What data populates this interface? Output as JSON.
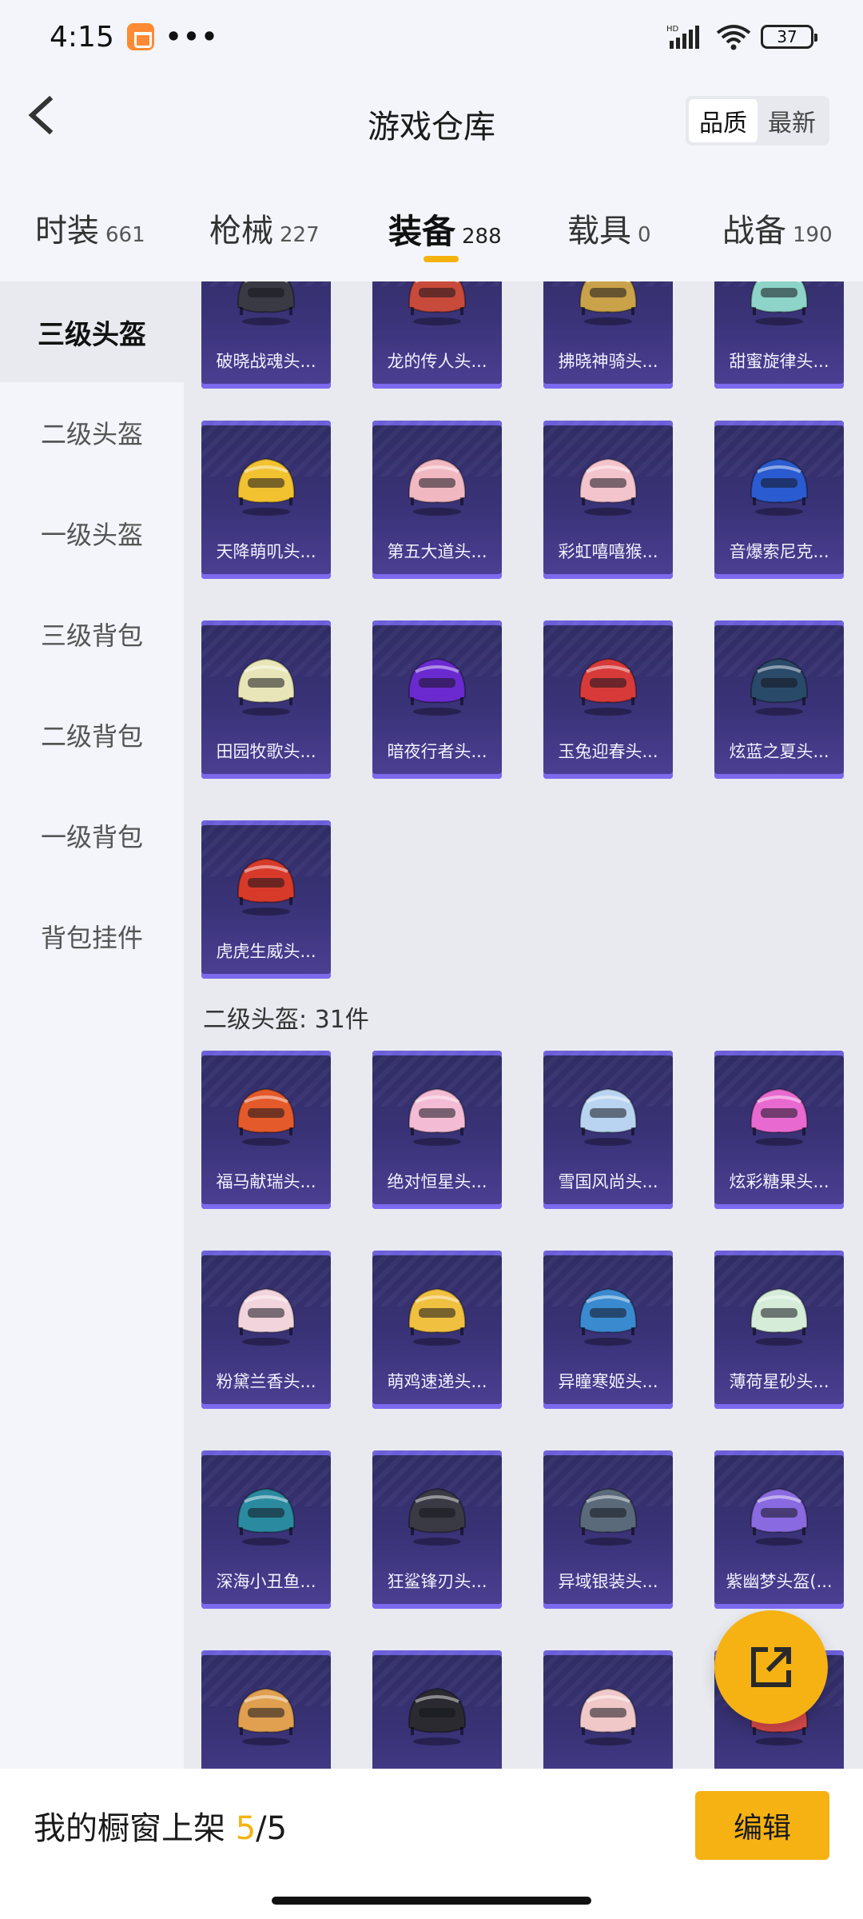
{
  "status_bar": {
    "time": "4:15",
    "dots": "•••",
    "battery": "37"
  },
  "header": {
    "title": "游戏仓库",
    "sort_options": [
      {
        "label": "品质",
        "active": true
      },
      {
        "label": "最新",
        "active": false
      }
    ]
  },
  "tabs": [
    {
      "label": "时装",
      "count": "661"
    },
    {
      "label": "枪械",
      "count": "227"
    },
    {
      "label": "装备",
      "count": "288",
      "active": true
    },
    {
      "label": "载具",
      "count": "0"
    },
    {
      "label": "战备",
      "count": "190"
    }
  ],
  "sidebar": {
    "items": [
      {
        "label": "三级头盔",
        "active": true
      },
      {
        "label": "二级头盔"
      },
      {
        "label": "一级头盔"
      },
      {
        "label": "三级背包"
      },
      {
        "label": "二级背包"
      },
      {
        "label": "一级背包"
      },
      {
        "label": "背包挂件"
      }
    ]
  },
  "sections": {
    "level2_title": "二级头盔: 31件"
  },
  "cards": [
    {
      "label": "破晓战魂头...",
      "color": "#3a3a44"
    },
    {
      "label": "龙的传人头...",
      "color": "#c84a3a"
    },
    {
      "label": "拂晓神骑头...",
      "color": "#c9a24a"
    },
    {
      "label": "甜蜜旋律头...",
      "color": "#8ed4c8"
    },
    {
      "label": "天降萌叽头...",
      "color": "#f2c230"
    },
    {
      "label": "第五大道头...",
      "color": "#f2b8c2"
    },
    {
      "label": "彩虹嘻嘻猴...",
      "color": "#f4c4cc"
    },
    {
      "label": "音爆索尼克...",
      "color": "#2a5bd0"
    },
    {
      "label": "田园牧歌头...",
      "color": "#e8e6b8"
    },
    {
      "label": "暗夜行者头...",
      "color": "#6a2ad0"
    },
    {
      "label": "玉兔迎春头...",
      "color": "#d83a3a"
    },
    {
      "label": "炫蓝之夏头...",
      "color": "#2a4a6a"
    },
    {
      "label": "虎虎生威头...",
      "color": "#d83a2a"
    },
    {
      "label": "福马献瑞头...",
      "color": "#e45a2a"
    },
    {
      "label": "绝对恒星头...",
      "color": "#f4bcd4"
    },
    {
      "label": "雪国风尚头...",
      "color": "#b8d4f0"
    },
    {
      "label": "炫彩糖果头...",
      "color": "#e86ad0"
    },
    {
      "label": "粉黛兰香头...",
      "color": "#f2d4dc"
    },
    {
      "label": "萌鸡速递头...",
      "color": "#f0c040"
    },
    {
      "label": "异瞳寒姬头...",
      "color": "#3a8ad0"
    },
    {
      "label": "薄荷星砂头...",
      "color": "#d4ecd8"
    },
    {
      "label": "深海小丑鱼...",
      "color": "#2a8aa0"
    },
    {
      "label": "狂鲨锋刃头...",
      "color": "#3a3a44"
    },
    {
      "label": "异域银装头...",
      "color": "#5a6a7a"
    },
    {
      "label": "紫幽梦头盔(...",
      "color": "#8a6ae0"
    },
    {
      "label": "",
      "color": "#e0a050"
    },
    {
      "label": "",
      "color": "#2a2a30"
    },
    {
      "label": "",
      "color": "#f0c8c8"
    },
    {
      "label": "",
      "color": "#d84a4a"
    }
  ],
  "bottom_bar": {
    "showcase_label": "我的橱窗上架",
    "showcase_current": "5",
    "showcase_total": "/5",
    "edit_label": "编辑"
  },
  "colors": {
    "accent": "#f6b213",
    "card_top": "#2f2c63",
    "card_bottom": "#4c3f94"
  }
}
